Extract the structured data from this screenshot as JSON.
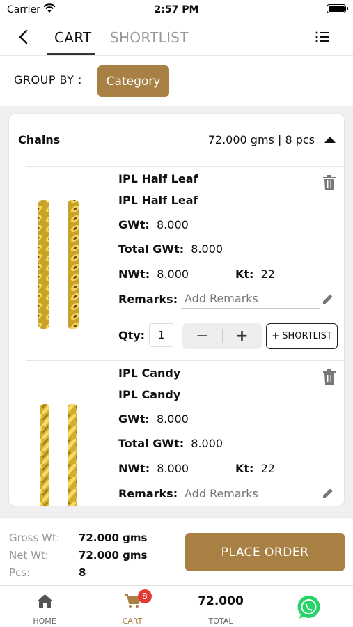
{
  "status_bar": {
    "carrier": "Carrier",
    "time": "2:57 PM"
  },
  "topnav": {
    "tabs": [
      "CART",
      "SHORTLIST"
    ]
  },
  "groupby": {
    "label": "GROUP BY :",
    "button": "Category"
  },
  "group": {
    "title": "Chains",
    "summary": "72.000 gms | 8 pcs"
  },
  "labels": {
    "gwt": "GWt:",
    "total_gwt": "Total GWt:",
    "nwt": "NWt:",
    "kt": "Kt:",
    "remarks": "Remarks:",
    "remarks_placeholder": "Add Remarks",
    "qty": "Qty:",
    "minus": "−",
    "plus": "+",
    "shortlist": "+ SHORTLIST"
  },
  "items": [
    {
      "name": "IPL Half Leaf",
      "subname": "IPL Half Leaf",
      "gwt": "8.000",
      "total_gwt": "8.000",
      "nwt": "8.000",
      "kt": "22",
      "qty": "1"
    },
    {
      "name": "IPL Candy",
      "subname": "IPL Candy",
      "gwt": "8.000",
      "total_gwt": "8.000",
      "nwt": "8.000",
      "kt": "22"
    }
  ],
  "summary": {
    "gross_label": "Gross Wt:",
    "gross_value": "72.000 gms",
    "net_label": "Net Wt:",
    "net_value": "72.000 gms",
    "pcs_label": "Pcs:",
    "pcs_value": "8",
    "place_order": "PLACE ORDER"
  },
  "bottom_nav": {
    "home": "HOME",
    "cart": "CART",
    "cart_badge": "8",
    "total_value": "72.000",
    "total_label": "TOTAL"
  },
  "colors": {
    "accent": "#a98044",
    "badge": "#e53935",
    "whatsapp": "#25d366"
  },
  "icons": [
    "back-icon",
    "menu-icon",
    "caret-up-icon",
    "trash-icon",
    "edit-icon",
    "home-icon",
    "cart-icon",
    "whatsapp-icon",
    "wifi-icon",
    "battery-icon"
  ]
}
